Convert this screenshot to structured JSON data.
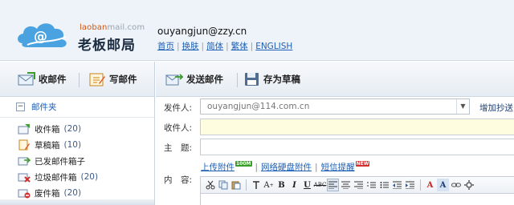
{
  "header": {
    "logo_en_prefix": "laoban",
    "logo_en_suffix": "mail.com",
    "logo_cn": "老板邮局",
    "user_email": "ouyangjun@zzy.cn",
    "links": [
      "首页",
      "换肤",
      "简体",
      "繁体",
      "ENGLISH"
    ]
  },
  "sidebar": {
    "inbox_button": "收邮件",
    "compose_button": "写邮件",
    "folder_header": "邮件夹",
    "folders": [
      {
        "label": "收件箱",
        "count": "(20)",
        "icon": "inbox-icon"
      },
      {
        "label": "草稿箱",
        "count": "(10)",
        "icon": "drafts-icon"
      },
      {
        "label": "已发邮件箱子",
        "count": "",
        "icon": "sent-icon"
      },
      {
        "label": "垃圾邮件箱",
        "count": "(20)",
        "icon": "spam-icon"
      },
      {
        "label": "废件箱",
        "count": "(20)",
        "icon": "trash-icon"
      }
    ]
  },
  "toolbar": {
    "send_button": "发送邮件",
    "save_draft_button": "存为草稿"
  },
  "form": {
    "sender_label": "发件人:",
    "sender_value": "ouyangjun@114.com.cn",
    "add_cc_label": "增加抄送",
    "recipient_label": "收件人:",
    "recipient_value": "",
    "subject_label": "主　题:",
    "subject_value": "",
    "content_label": "内　容:",
    "attach_upload": "上传附件",
    "attach_upload_badge": "100M",
    "attach_disk": "网络硬盘附件",
    "sms_reminder": "短信提醒",
    "sms_badge": "NEW"
  },
  "editor": {
    "buttons": [
      "cut",
      "copy",
      "paste",
      "format-painter",
      "font-size",
      "bold",
      "italic",
      "underline",
      "strikethrough",
      "align-left",
      "align-center",
      "align-right",
      "ordered-list",
      "unordered-list",
      "outdent",
      "indent",
      "font-color",
      "highlight",
      "link",
      "more"
    ]
  },
  "colors": {
    "header_bg": "#eef3f9",
    "link_blue": "#1d5fb4",
    "recipient_bg": "#fffde0",
    "logo_orange": "#d9530b"
  }
}
